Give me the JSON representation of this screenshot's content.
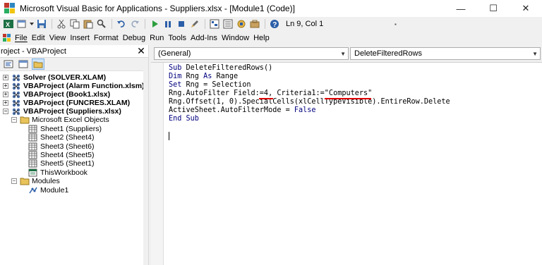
{
  "window": {
    "title": "Microsoft Visual Basic for Applications - Suppliers.xlsx - [Module1 (Code)]",
    "controls": {
      "minimize": "—",
      "maximize": "☐",
      "close": "✕"
    }
  },
  "toolbar": {
    "position": "Ln 9, Col 1"
  },
  "menu": {
    "items": [
      "File",
      "Edit",
      "View",
      "Insert",
      "Format",
      "Debug",
      "Run",
      "Tools",
      "Add-Ins",
      "Window",
      "Help"
    ]
  },
  "project": {
    "title": "roject - VBAProject",
    "close": "✕",
    "tree": [
      {
        "label": "Solver (SOLVER.XLAM)"
      },
      {
        "label": "VBAProject (Alarm Function.xlsm)"
      },
      {
        "label": "VBAProject (Book1.xlsx)"
      },
      {
        "label": "VBAProject (FUNCRES.XLAM)"
      },
      {
        "label": "VBAProject (Suppliers.xlsx)"
      },
      {
        "label": "Microsoft Excel Objects"
      },
      {
        "label": "Sheet1 (Suppliers)"
      },
      {
        "label": "Sheet2 (Sheet4)"
      },
      {
        "label": "Sheet3 (Sheet6)"
      },
      {
        "label": "Sheet4 (Sheet5)"
      },
      {
        "label": "Sheet5 (Sheet1)"
      },
      {
        "label": "ThisWorkbook"
      },
      {
        "label": "Modules"
      },
      {
        "label": "Module1"
      }
    ]
  },
  "code": {
    "object_combo": "(General)",
    "proc_combo": "DeleteFilteredRows",
    "lines": {
      "l1_kw": "Sub",
      "l1_rest": " DeleteFilteredRows()",
      "l2_kw": "Dim",
      "l2_mid": " Rng ",
      "l2_kw2": "As",
      "l2_rest": " Range",
      "l3_kw": "Set",
      "l3_rest": " Rng = Selection",
      "l4": "Rng.AutoFilter Field:=4, Criteria1:=\"Computers\"",
      "l5": "Rng.Offset(1, 0).SpecialCells(xlCellTypeVisible).EntireRow.Delete",
      "l6_pre": "ActiveSheet.AutoFilterMode = ",
      "l6_kw": "False",
      "l7_kw": "End Sub"
    }
  },
  "colors": {
    "keyword": "#00007f",
    "underline": "#e00000",
    "toolbar_bg": "#f0f0f0"
  }
}
